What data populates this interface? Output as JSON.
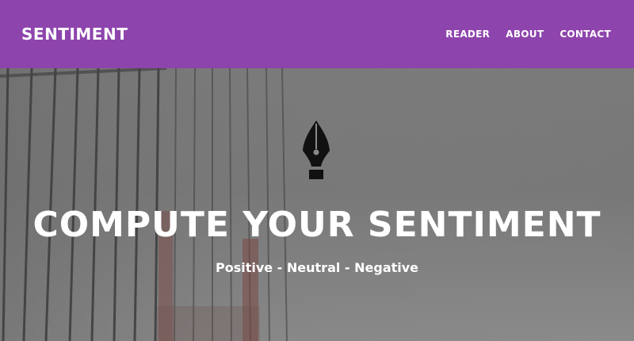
{
  "brand": {
    "name": "SENTIMENT"
  },
  "nav": {
    "items": [
      {
        "label": "READER"
      },
      {
        "label": "ABOUT"
      },
      {
        "label": "CONTACT"
      }
    ]
  },
  "hero": {
    "icon": "fountain-pen-nib-icon",
    "headline": "COMPUTE YOUR SENTIMENT",
    "subheadline": "Positive - Neutral - Negative"
  },
  "colors": {
    "navbar_bg": "#8e44ad",
    "text": "#ffffff",
    "hero_overlay": "#777777"
  }
}
